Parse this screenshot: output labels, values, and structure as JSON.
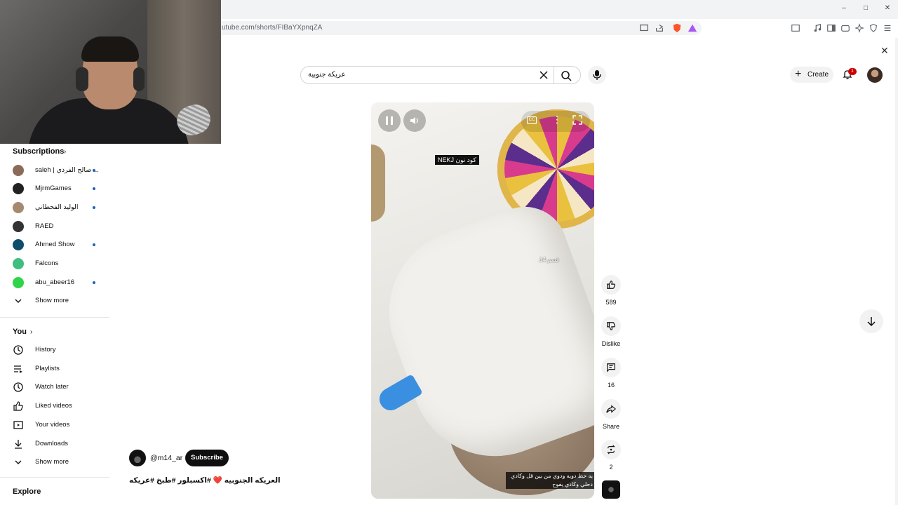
{
  "browser": {
    "url": "utube.com/shorts/FIBaYXpnqZA",
    "window_controls": {
      "minimize": "–",
      "maximize": "□",
      "close": "✕"
    }
  },
  "header": {
    "search_value": "عريكة جنوبية",
    "create_label": "Create",
    "notification_count": "1"
  },
  "sidebar": {
    "subscriptions_title": "Subscriptions",
    "subscriptions": [
      {
        "label": "saleh | صالح الفردي ...",
        "color": "#8a6b5a",
        "new": true
      },
      {
        "label": "MjrmGames",
        "color": "#222222",
        "new": true
      },
      {
        "label": "الوليد الفحطاني",
        "color": "#a58a70",
        "new": true
      },
      {
        "label": "RAED",
        "color": "#333333",
        "new": false
      },
      {
        "label": "Ahmed Show",
        "color": "#0f4d6b",
        "new": true
      },
      {
        "label": "Falcons",
        "color": "#3fbf7f",
        "new": false
      },
      {
        "label": "abu_abeer16",
        "color": "#2fd44a",
        "new": true
      }
    ],
    "subs_show_more": "Show more",
    "you_title": "You",
    "you_items": [
      {
        "label": "History",
        "icon": "history-icon"
      },
      {
        "label": "Playlists",
        "icon": "playlists-icon"
      },
      {
        "label": "Watch later",
        "icon": "watch-later-icon"
      },
      {
        "label": "Liked videos",
        "icon": "liked-videos-icon"
      },
      {
        "label": "Your videos",
        "icon": "your-videos-icon"
      },
      {
        "label": "Downloads",
        "icon": "downloads-icon"
      }
    ],
    "you_show_more": "Show more",
    "explore_title": "Explore"
  },
  "video": {
    "caption_top": "كود نون NEKJ",
    "caption_mid": "قسم 14.",
    "caption_bottom": "يه حط دويه ودوي من بين قل وكادي دحلي وكادي يفوح"
  },
  "channel": {
    "handle": "@m14_ar",
    "subscribe_label": "Subscribe",
    "title": "العريكه الجنوبيه ❤️ #اكسبلور #طبخ #عريكه"
  },
  "actions": {
    "like_count": "589",
    "dislike_label": "Dislike",
    "comment_count": "16",
    "share_label": "Share",
    "remix_count": "2"
  }
}
